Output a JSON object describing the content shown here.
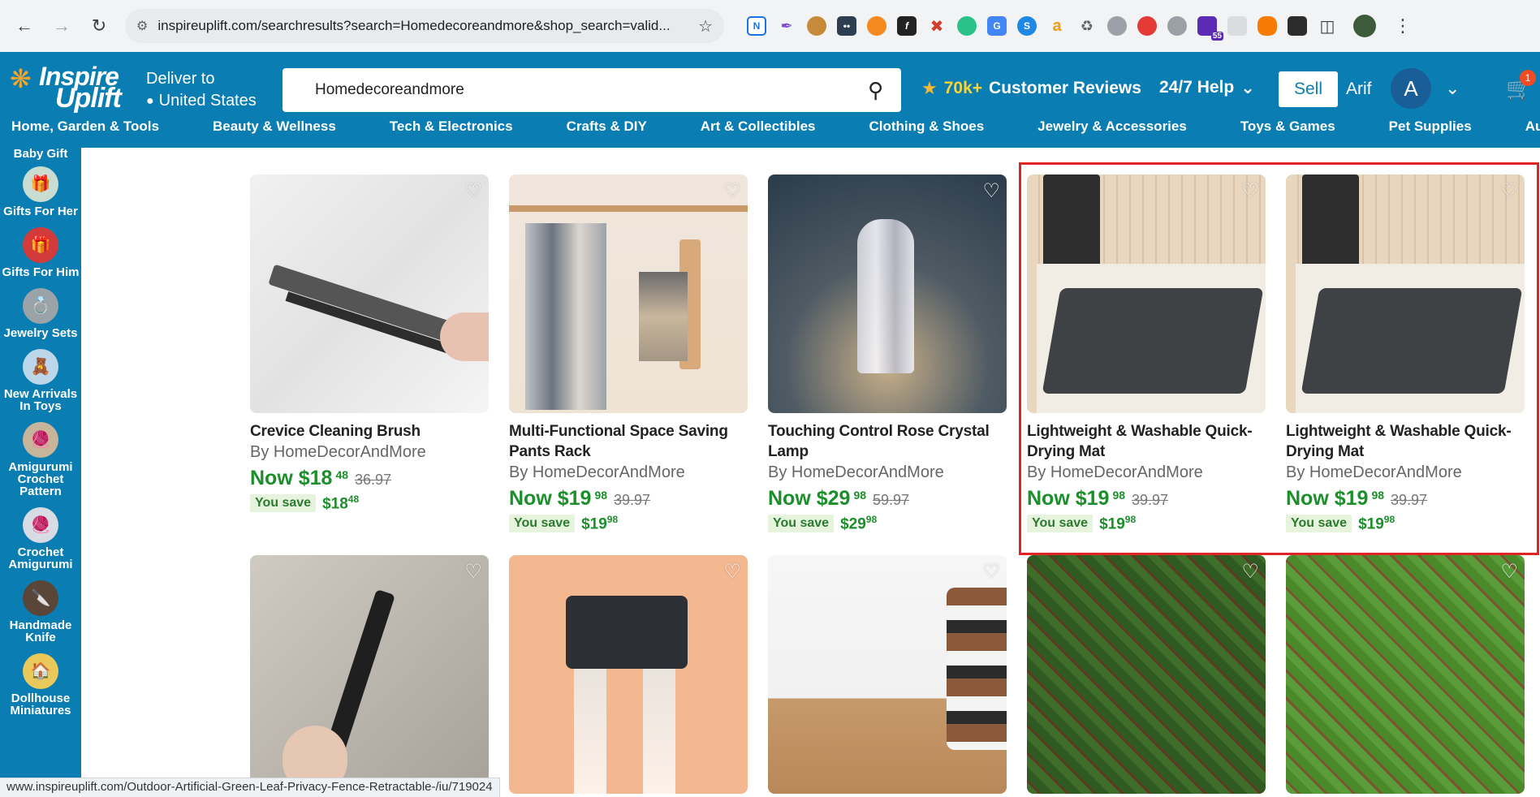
{
  "browser": {
    "url": "inspireuplift.com/searchresults?search=Homedecoreandmore&shop_search=valid...",
    "status_url": "www.inspireuplift.com/Outdoor-Artificial-Green-Leaf-Privacy-Fence-Retractable-/iu/719024",
    "extensions": [
      "N-icon",
      "pen-icon",
      "cookie-icon",
      "terminal-icon",
      "puzzle-color-icon",
      "f-icon",
      "x-icon",
      "circle-icon",
      "translate-icon",
      "s-icon",
      "amazon-icon",
      "recycle-icon",
      "globe-icon",
      "eye-icon",
      "tab-icon",
      "grad-icon",
      "square-icon",
      "fire-icon",
      "scale-icon",
      "puzzle-icon"
    ],
    "ext_badge": "55"
  },
  "header": {
    "logo_line1": "Inspire",
    "logo_line2": "Uplift",
    "deliver_label": "Deliver to",
    "deliver_location": "United States",
    "search_value": "Homedecoreandmore",
    "reviews_count": "70k+",
    "reviews_label": "Customer Reviews",
    "help_label": "24/7 Help",
    "sell_label": "Sell",
    "user_name": "Arif",
    "avatar_initial": "A",
    "cart_count": "1"
  },
  "categories": [
    "Home, Garden & Tools",
    "Beauty & Wellness",
    "Tech & Electronics",
    "Crafts & DIY",
    "Art & Collectibles",
    "Clothing & Shoes",
    "Jewelry & Accessories",
    "Toys & Games",
    "Pet Supplies",
    "Automotive"
  ],
  "sidebar": {
    "top_label": "Baby Gift",
    "items": [
      {
        "label": "Gifts For Her"
      },
      {
        "label": "Gifts For Him"
      },
      {
        "label": "Jewelry Sets"
      },
      {
        "label": "New Arrivals In Toys"
      },
      {
        "label": "Amigurumi Crochet Pattern"
      },
      {
        "label": "Crochet Amigurumi"
      },
      {
        "label": "Handmade Knife"
      },
      {
        "label": "Dollhouse Miniatures"
      }
    ]
  },
  "products_row1": [
    {
      "title": "Crevice Cleaning Brush",
      "brand": "By HomeDecorAndMore",
      "now": "Now $18",
      "cents": "48",
      "orig": "36.97",
      "save_label": "You save",
      "save": "$18",
      "save_cents": "48"
    },
    {
      "title": "Multi-Functional Space Saving Pants Rack",
      "brand": "By HomeDecorAndMore",
      "now": "Now $19",
      "cents": "98",
      "orig": "39.97",
      "save_label": "You save",
      "save": "$19",
      "save_cents": "98"
    },
    {
      "title": "Touching Control Rose Crystal Lamp",
      "brand": "By HomeDecorAndMore",
      "now": "Now $29",
      "cents": "98",
      "orig": "59.97",
      "save_label": "You save",
      "save": "$29",
      "save_cents": "98"
    },
    {
      "title": "Lightweight & Washable Quick-Drying Mat",
      "brand": "By HomeDecorAndMore",
      "now": "Now $19",
      "cents": "98",
      "orig": "39.97",
      "save_label": "You save",
      "save": "$19",
      "save_cents": "98"
    },
    {
      "title": "Lightweight & Washable Quick-Drying Mat",
      "brand": "By HomeDecorAndMore",
      "now": "Now $19",
      "cents": "98",
      "orig": "39.97",
      "save_label": "You save",
      "save": "$19",
      "save_cents": "98"
    }
  ],
  "colors": {
    "brand": "#0a7db3",
    "price_green": "#1b8f2a",
    "highlight": "#e02424"
  }
}
